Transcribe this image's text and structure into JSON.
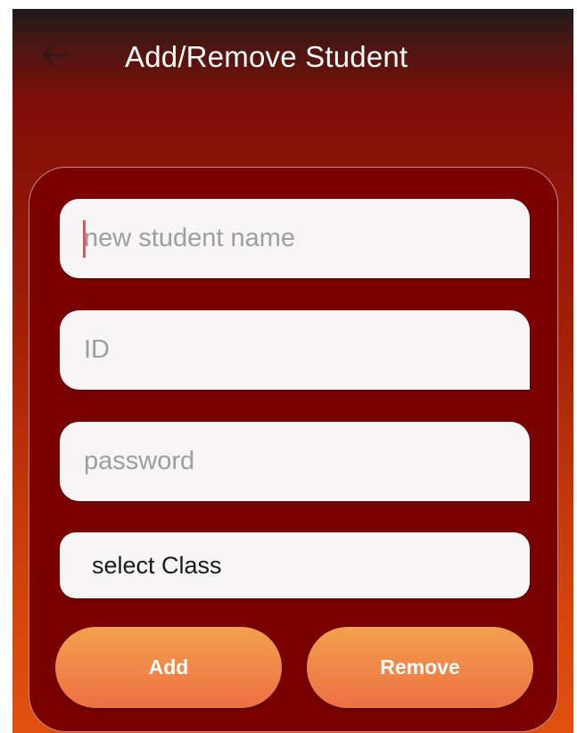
{
  "header": {
    "title": "Add/Remove Student",
    "back_icon": "arrow-left-icon"
  },
  "form": {
    "name_placeholder": "new student name",
    "id_placeholder": "ID",
    "password_placeholder": "password",
    "class_select_value": "select Class",
    "add_label": "Add",
    "remove_label": "Remove"
  },
  "colors": {
    "card_background": "#7a0000",
    "button_gradient_top": "#f1a04e",
    "button_gradient_bottom": "#ee6f45",
    "cursor": "#e0535f"
  }
}
